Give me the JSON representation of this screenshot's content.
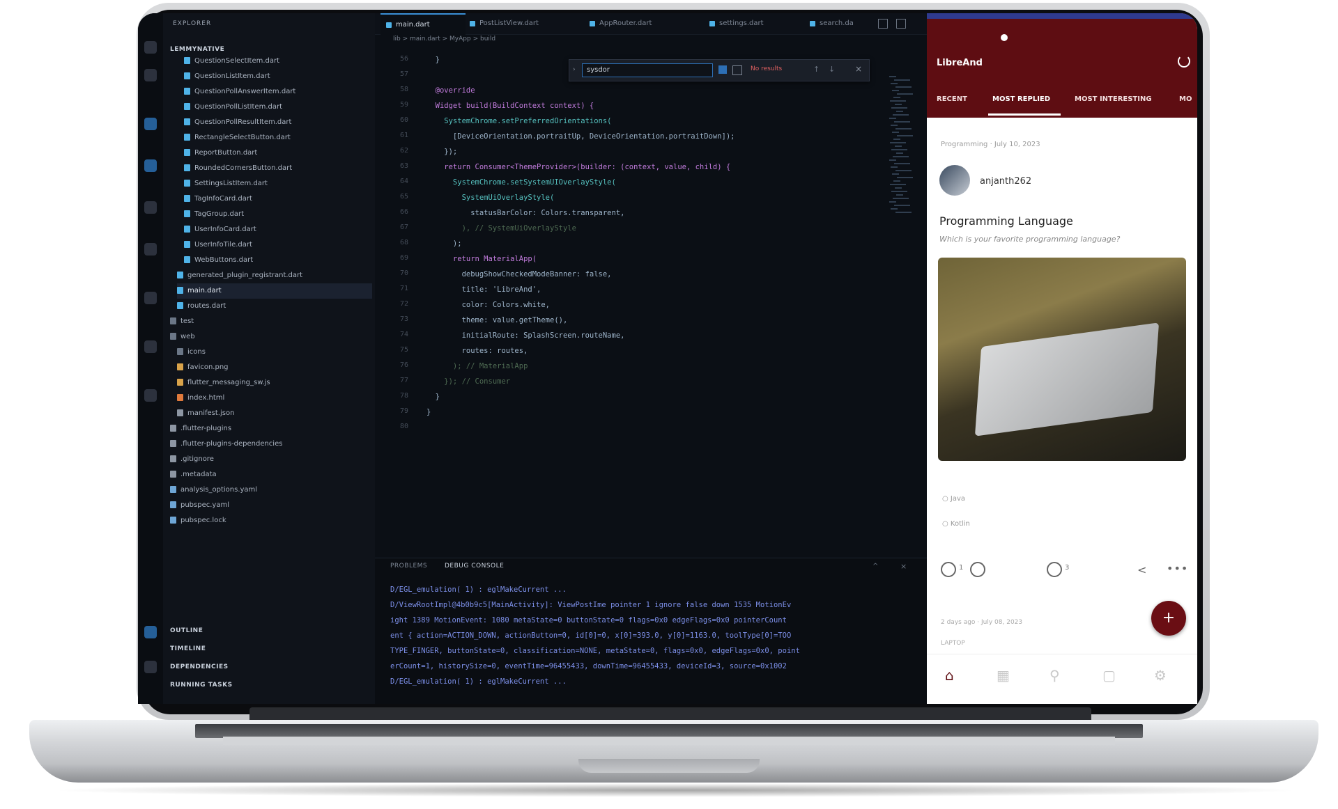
{
  "vscode": {
    "sidebar": {
      "title": "EXPLORER",
      "root": "LEMMYNATIVE",
      "files": [
        "QuestionSelectItem.dart",
        "QuestionListItem.dart",
        "QuestionPollAnswerItem.dart",
        "QuestionPollListItem.dart",
        "QuestionPollResultItem.dart",
        "RectangleSelectButton.dart",
        "ReportButton.dart",
        "RoundedCornersButton.dart",
        "SettingsListItem.dart",
        "TagInfoCard.dart",
        "TagGroup.dart",
        "UserInfoCard.dart",
        "UserInfoTile.dart",
        "WebButtons.dart",
        "generated_plugin_registrant.dart",
        "main.dart",
        "routes.dart",
        "test",
        "web",
        "icons",
        "favicon.png",
        "flutter_messaging_sw.js",
        "index.html",
        "manifest.json",
        ".flutter-plugins",
        ".flutter-plugins-dependencies",
        ".gitignore",
        ".metadata",
        "analysis_options.yaml",
        "pubspec.yaml",
        "pubspec.lock"
      ],
      "sections": [
        "OUTLINE",
        "TIMELINE",
        "DEPENDENCIES",
        "RUNNING TASKS"
      ]
    },
    "tabs": [
      "main.dart",
      "PostListView.dart",
      "AppRouter.dart",
      "settings.dart",
      "search.da"
    ],
    "breadcrumb": "lib > main.dart > MyApp > build",
    "find": {
      "value": "sysdor",
      "status": "No results"
    },
    "line_numbers": [
      "56",
      "57",
      "58",
      "59",
      "60",
      "61",
      "62",
      "63",
      "64",
      "65",
      "66",
      "67",
      "68",
      "69",
      "70",
      "71",
      "72",
      "73",
      "74",
      "75",
      "76",
      "77",
      "78",
      "79",
      "80"
    ],
    "code_lines": [
      "  }",
      "",
      "  @override",
      "  Widget build(BuildContext context) {",
      "    SystemChrome.setPreferredOrientations(",
      "      [DeviceOrientation.portraitUp, DeviceOrientation.portraitDown]);",
      "    });",
      "    return Consumer<ThemeProvider>(builder: (context, value, child) {",
      "      SystemChrome.setSystemUIOverlayStyle(",
      "        SystemUiOverlayStyle(",
      "          statusBarColor: Colors.transparent,",
      "        ), // SystemUiOverlayStyle",
      "      );",
      "      return MaterialApp(",
      "        debugShowCheckedModeBanner: false,",
      "        title: 'LibreAnd',",
      "        color: Colors.white,",
      "        theme: value.getTheme(),",
      "        initialRoute: SplashScreen.routeName,",
      "        routes: routes,",
      "      ); // MaterialApp",
      "    }); // Consumer",
      "  }",
      "}",
      ""
    ],
    "panel_tabs": [
      "PROBLEMS",
      "DEBUG CONSOLE"
    ],
    "terminal_lines": [
      "D/EGL_emulation( 1) : eglMakeCurrent ...",
      "D/ViewRootImpl@4b0b9c5[MainActivity]: ViewPostIme pointer 1 ignore false down 1535 MotionEv",
      "ight 1389 MotionEvent: 1080 metaState=0 buttonState=0 flags=0x0 edgeFlags=0x0 pointerCount",
      "ent { action=ACTION_DOWN, actionButton=0, id[0]=0, x[0]=393.0, y[0]=1163.0, toolType[0]=TOO",
      "TYPE_FINGER, buttonState=0, classification=NONE, metaState=0, flags=0x0, edgeFlags=0x0, point",
      "erCount=1, historySize=0, eventTime=96455433, downTime=96455433, deviceId=3, source=0x1002",
      "D/EGL_emulation( 1) : eglMakeCurrent ..."
    ]
  },
  "app": {
    "title": "LibreAnd",
    "tabs": [
      "RECENT",
      "MOST REPLIED",
      "MOST INTERESTING",
      "MO"
    ],
    "post": {
      "meta": "Programming · July 10, 2023",
      "username": "anjanth262",
      "title": "Programming Language",
      "subtitle": "Which is your favorite programming language?",
      "poll_options": [
        "Java",
        "Kotlin"
      ],
      "upvotes": "1",
      "comments": "3"
    },
    "footer_meta": "2 days ago · July 08, 2023",
    "footer_label": "LAPTOP",
    "fab_label": "+",
    "nav": [
      "home-icon",
      "grid-icon",
      "search-icon",
      "bookmark-icon",
      "settings-icon"
    ],
    "colors": {
      "header": "#5e0d12",
      "status_bar": "#2f3a8e",
      "active_nav": "#5e0d12"
    }
  }
}
